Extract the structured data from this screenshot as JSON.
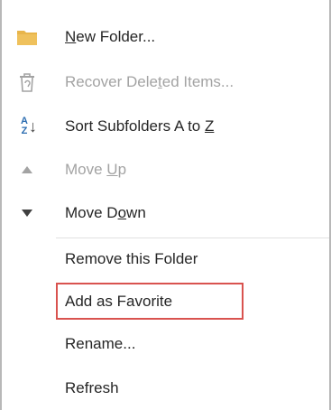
{
  "menu": {
    "items": [
      {
        "name": "new-folder",
        "pre": "",
        "accel": "N",
        "post": "ew Folder...",
        "icon": "folder-icon",
        "disabled": false
      },
      {
        "name": "recover-deleted-items",
        "pre": "Recover Dele",
        "accel": "t",
        "post": "ed Items...",
        "icon": "recycle-bin-icon",
        "disabled": true
      },
      {
        "name": "sort-subfolders",
        "pre": "Sort Subfolders A to ",
        "accel": "Z",
        "post": "",
        "icon": "sort-az-icon",
        "disabled": false
      },
      {
        "name": "move-up",
        "pre": "Move ",
        "accel": "U",
        "post": "p",
        "icon": "triangle-up-icon",
        "disabled": true
      },
      {
        "name": "move-down",
        "pre": "Move D",
        "accel": "o",
        "post": "wn",
        "icon": "triangle-down-icon",
        "disabled": false
      },
      {
        "name": "remove-folder",
        "pre": "Remove this Folder",
        "accel": "",
        "post": "",
        "icon": "",
        "disabled": false
      },
      {
        "name": "add-as-favorite",
        "pre": "Add as Favorite",
        "accel": "",
        "post": "",
        "icon": "",
        "disabled": false,
        "highlighted": true
      },
      {
        "name": "rename",
        "pre": "Rename...",
        "accel": "",
        "post": "",
        "icon": "",
        "disabled": false
      },
      {
        "name": "refresh",
        "pre": "Refresh",
        "accel": "",
        "post": "",
        "icon": "",
        "disabled": false
      }
    ],
    "sort_icon_top": "A",
    "sort_icon_bottom": "Z",
    "sort_icon_arrow": "↓",
    "colors": {
      "text": "#262626",
      "disabled_text": "#a3a3a3",
      "folder": "#e8b54a",
      "highlight_border": "#d9534f",
      "sort_blue": "#2b6cb0"
    }
  }
}
